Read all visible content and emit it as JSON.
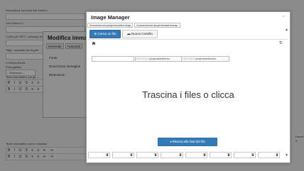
{
  "background": {
    "rows": [
      "Descrizione secondo link esterno",
      "Link esterno 1",
      "Codici per SEO - sottoriga su...",
      "Tags - separate da virgola",
      "CONSULENZA",
      "Photogallery",
      "Testo introduttivo per gli ...",
      "Testo introduttivo per le soluzioni"
    ],
    "select_value": "-- Seleziona --",
    "editor_toolbar": "B I U S ≡ ≡ ⇤ ⇥",
    "side_label": "Parole: 3"
  },
  "modifica_dialog": {
    "title": "Modifica immagin",
    "tabs": [
      "Generale",
      "Avanzate"
    ],
    "items": [
      "Fonte",
      "Descrizione immagine",
      "Dimensioni"
    ]
  },
  "image_manager": {
    "title": "Image Manager",
    "close": "×",
    "path_crumbs": [
      "/home/server/projects/anthericap",
      "/home/server/projects/anthericap"
    ],
    "upload_label": "Carica un file",
    "new_folder_label": "Nuova Cartella",
    "path_field_1": "/ / / / / / / / / /projects/anthericu",
    "path_field_2": "/ / / / / / / / / /projects/anthericu",
    "dropzone_text": "Trascina i files o clicca",
    "back_label": "Ritorna alla lista dei file",
    "file_slot_count": 8
  },
  "icons": {
    "home": "home-icon",
    "refresh": "refresh-icon",
    "upload": "upload-icon",
    "folder": "folder-icon",
    "back": "arrow-left-icon",
    "trash": "trash-icon"
  },
  "colors": {
    "primary": "#337ab7",
    "overlay": "rgba(0,0,0,0.42)"
  }
}
